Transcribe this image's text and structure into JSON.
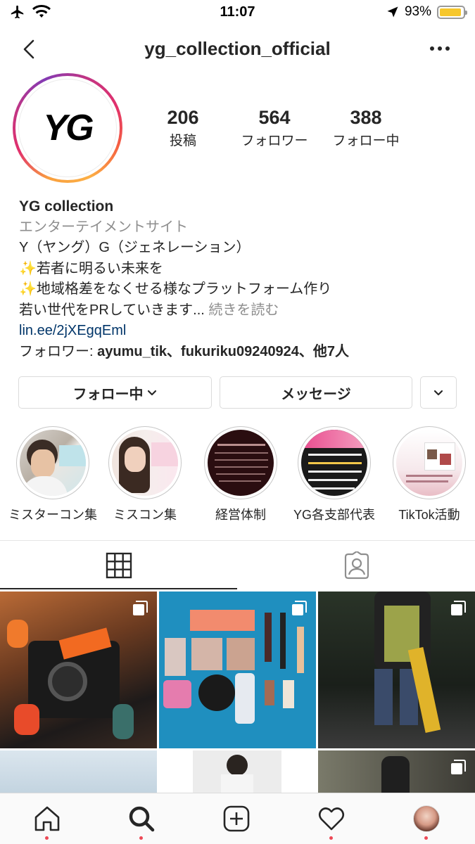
{
  "status": {
    "time": "11:07",
    "battery": "93%",
    "battery_level": 0.93,
    "icons": [
      "airplane-icon",
      "wifi-icon",
      "location-arrow-icon",
      "battery-icon"
    ]
  },
  "nav": {
    "title": "yg_collection_official",
    "icons": [
      "back-chevron-icon",
      "more-dots-icon"
    ]
  },
  "profile": {
    "avatar_text": "YG",
    "stats": [
      {
        "value": "206",
        "label": "投稿"
      },
      {
        "value": "564",
        "label": "フォロワー"
      },
      {
        "value": "388",
        "label": "フォロー中"
      }
    ],
    "name": "YG  collection",
    "category": "エンターテイメントサイト",
    "bio_lines": [
      "Y（ヤング）G（ジェネレーション）",
      "✨若者に明るい未来を",
      "✨地域格差をなくせる様なプラットフォーム作り",
      "若い世代をPRしていきます..."
    ],
    "more_label": " 続きを読む",
    "link": "lin.ee/2jXEgqEml",
    "followers_prefix": "フォロワー: ",
    "followers_names": "ayumu_tik、fukuriku09240924、他7人"
  },
  "actions": {
    "following_label": "フォロー中",
    "message_label": "メッセージ",
    "icons": [
      "chevron-down-icon"
    ]
  },
  "highlights": [
    {
      "label": "ミスターコン集"
    },
    {
      "label": "ミスコン集"
    },
    {
      "label": "経営体制"
    },
    {
      "label": "YG各支部代表"
    },
    {
      "label": "TikTok活動"
    }
  ],
  "tabs": [
    {
      "name": "grid",
      "icon": "grid-icon"
    },
    {
      "name": "tagged",
      "icon": "tagged-person-icon"
    }
  ],
  "bottom_nav": [
    {
      "name": "home",
      "icon": "home-icon",
      "dot": true
    },
    {
      "name": "search",
      "icon": "search-icon",
      "dot": true
    },
    {
      "name": "create",
      "icon": "add-post-icon",
      "dot": false
    },
    {
      "name": "activity",
      "icon": "heart-icon",
      "dot": true
    },
    {
      "name": "profile",
      "icon": "profile-avatar-icon",
      "dot": true
    }
  ],
  "colors": {
    "text": "#262626",
    "muted": "#8e8e8e",
    "link": "#003569",
    "notification_dot": "#ed4956",
    "battery": "#f6c72c"
  }
}
